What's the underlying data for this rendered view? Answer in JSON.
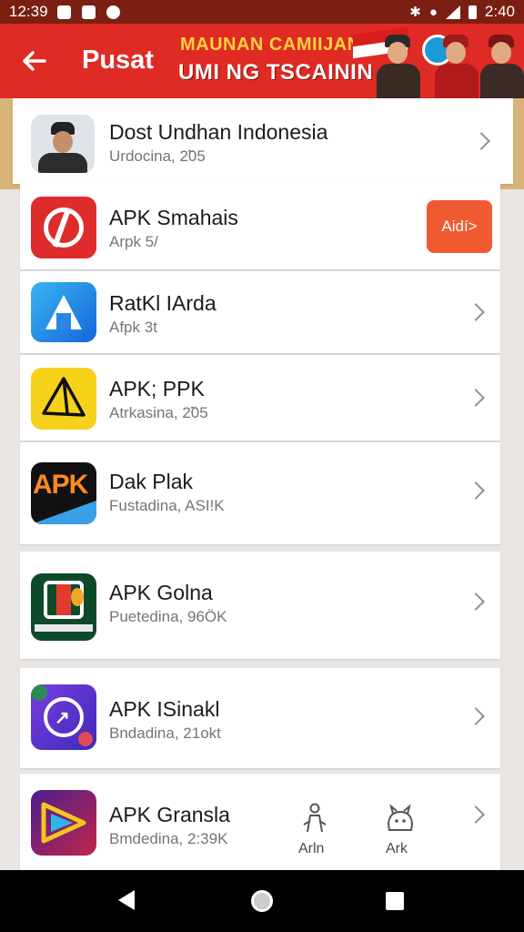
{
  "status_bar": {
    "time": "12:39",
    "clock_right": "2:40"
  },
  "header": {
    "back_icon": "arrow-left-icon",
    "title": "Pusat",
    "promo_line1": "MAUNAN CAMIIJAN",
    "promo_line2": "UMI NG TSCAININ"
  },
  "apps": [
    {
      "name": "Dost Undhan Indonesia",
      "sub": "Urdocina, 2̃05",
      "icon": "officer-portrait-icon",
      "action": "chevron"
    },
    {
      "name": "APK Smahais",
      "sub": "Arpk 5/",
      "icon": "red-ap-logo-icon",
      "action": "button",
      "button_label": "Aidí>"
    },
    {
      "name": "RatKl IArda",
      "sub": "Afpk 3t",
      "icon": "blue-a-logo-icon",
      "action": "chevron"
    },
    {
      "name": "APK; PPK",
      "sub": "Atrkasina, 2̃05",
      "icon": "yellow-triangle-logo-icon",
      "action": "chevron"
    },
    {
      "name": "Dak Plak",
      "sub": "Fustadina, ASI!K",
      "icon": "apk-text-logo-icon",
      "action": "chevron"
    },
    {
      "name": "APK Golna",
      "sub": "Puetedina, 96ÖK",
      "icon": "green-ornament-logo-icon",
      "action": "chevron"
    },
    {
      "name": "APK ISinakl",
      "sub": "Bndadina, 21okt",
      "icon": "purple-share-logo-icon",
      "action": "chevron"
    },
    {
      "name": "APK Gransla",
      "sub": "Bmdedina, 2:39K",
      "icon": "colorful-play-logo-icon",
      "action": "chevron",
      "extras": [
        {
          "label": "Arln",
          "icon": "person-figure-icon"
        },
        {
          "label": "Ark",
          "icon": "cute-creature-icon"
        }
      ]
    }
  ],
  "colors": {
    "header_red": "#e02a24",
    "status_dark": "#7a1f12",
    "button_orange": "#f05a30",
    "promo_yellow": "#ffd23f"
  }
}
